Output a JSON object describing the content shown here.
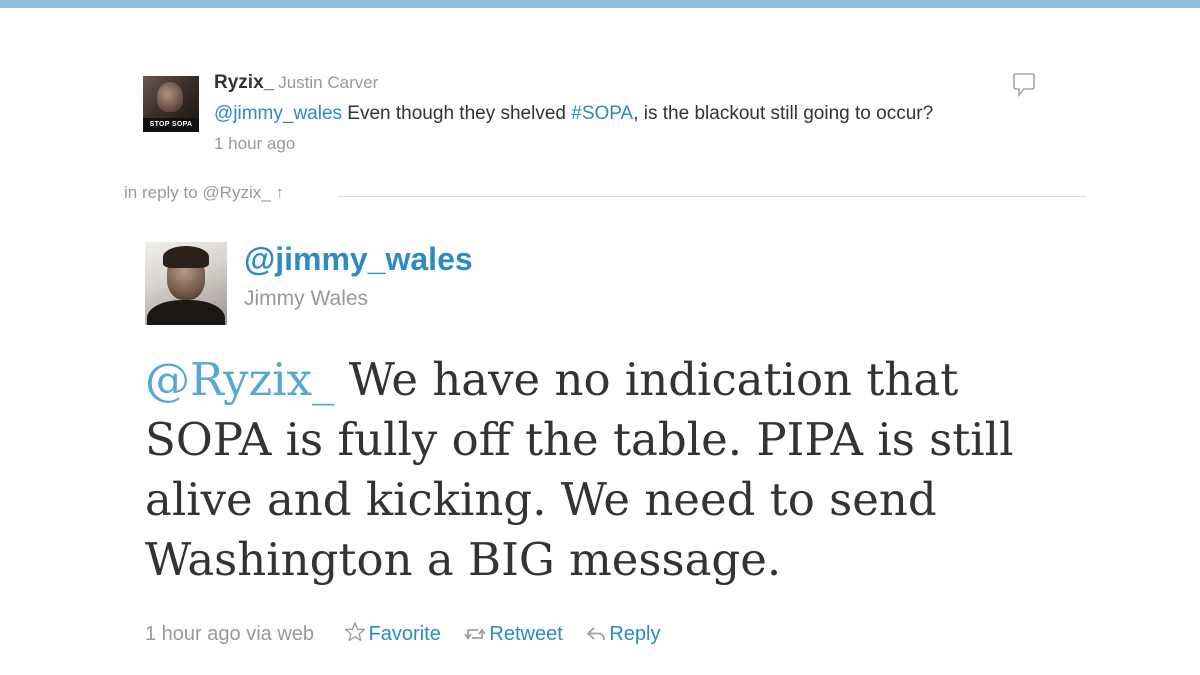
{
  "parent_tweet": {
    "avatar_caption": "STOP SOPA",
    "screen_name": "Ryzix_",
    "full_name": "Justin Carver",
    "text_mention": "@jimmy_wales",
    "text_part1": " Even though they shelved ",
    "text_hashtag": "#SOPA",
    "text_part2": ", is the blackout still going to occur?",
    "time": "1 hour ago",
    "reply_icon": "speech-bubble-icon"
  },
  "in_reply_to": {
    "label": "in reply to @Ryzix_",
    "arrow": "↑"
  },
  "main_tweet": {
    "screen_name": "@jimmy_wales",
    "full_name": "Jimmy Wales",
    "text_mention": "@Ryzix_",
    "text_line1_rest": " We have no indication that",
    "text_line2": "SOPA is fully off the table. PIPA is still",
    "text_line3": "alive and kicking. We need to send",
    "text_line4": "Washington a BIG message.",
    "time_via": "1 hour ago via web",
    "actions": {
      "favorite": "Favorite",
      "retweet": "Retweet",
      "reply": "Reply"
    }
  },
  "colors": {
    "top_bar": "#8ec1da",
    "link": "#2b8bc2",
    "muted": "#999999",
    "text": "#333333"
  }
}
